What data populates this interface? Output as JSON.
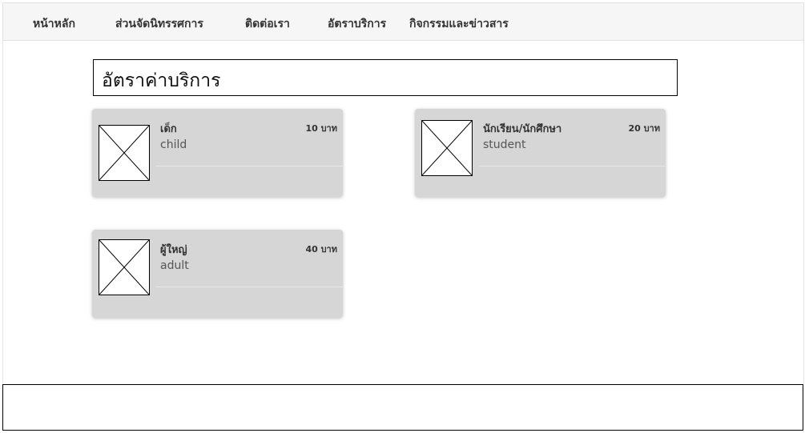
{
  "nav": {
    "items": [
      {
        "label": "หน้าหลัก"
      },
      {
        "label": "ส่วนจัดนิทรรศการ"
      },
      {
        "label": "ติดต่อเรา"
      },
      {
        "label": "อัตราบริการ"
      },
      {
        "label": "กิจกรรมและข่าวสาร"
      }
    ]
  },
  "main": {
    "title": "อัตราค่าบริการ",
    "rates": [
      {
        "name": "เด็ก",
        "subtitle": "child",
        "price": "10 บาท"
      },
      {
        "name": "นักเรียน/นักศึกษา",
        "subtitle": "student",
        "price": "20 บาท"
      },
      {
        "name": "ผู้ใหญ่",
        "subtitle": "adult",
        "price": "40 บาท"
      }
    ]
  },
  "colors": {
    "navbar_background": "#f6f6f6",
    "card_background": "#d6d6d6",
    "border": "#000000"
  }
}
